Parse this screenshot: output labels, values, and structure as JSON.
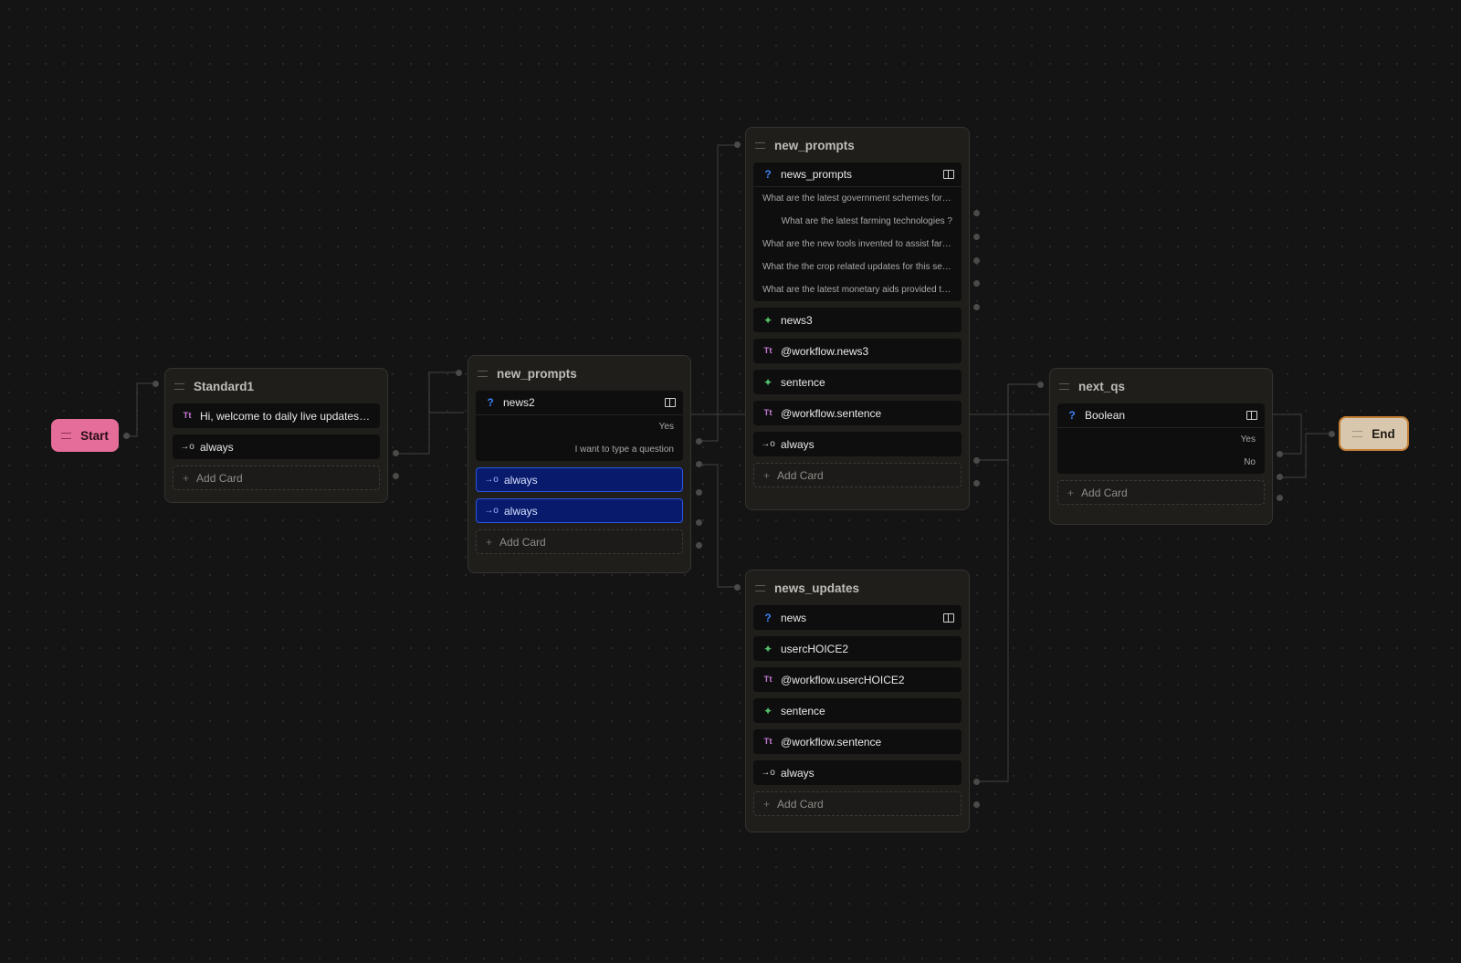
{
  "terminals": {
    "start_label": "Start",
    "end_label": "End"
  },
  "nodes": {
    "standard1": {
      "title": "Standard1",
      "rows": [
        {
          "icon": "text-icon",
          "text": "Hi, welcome to daily live updates by..."
        },
        {
          "icon": "arrow-icon",
          "text": "always"
        }
      ],
      "add_card": "Add Card"
    },
    "new_prompts_a": {
      "title": "new_prompts",
      "question": {
        "icon": "question-icon",
        "label": "news2",
        "options": [
          "Yes",
          "I want to type a question"
        ]
      },
      "rows": [
        {
          "icon": "arrow-icon",
          "text": "always"
        },
        {
          "icon": "arrow-icon",
          "text": "always"
        }
      ],
      "add_card": "Add Card"
    },
    "new_prompts_b": {
      "title": "new_prompts",
      "question": {
        "icon": "question-icon",
        "label": "news_prompts",
        "options": [
          "What are the latest government schemes for f...",
          "What are the latest farming technologies ?",
          "What are the new tools invented to assist farm...",
          "What the the crop related updates for this sea...",
          "What are the latest monetary aids provided to ..."
        ]
      },
      "rows": [
        {
          "icon": "sparkle-icon",
          "text": "news3"
        },
        {
          "icon": "text-icon",
          "text": "@workflow.news3"
        },
        {
          "icon": "sparkle-icon",
          "text": "sentence"
        },
        {
          "icon": "text-icon",
          "text": "@workflow.sentence"
        },
        {
          "icon": "arrow-icon",
          "text": "always"
        }
      ],
      "add_card": "Add Card"
    },
    "news_updates": {
      "title": "news_updates",
      "question": {
        "icon": "question-icon",
        "label": "news"
      },
      "rows": [
        {
          "icon": "sparkle-icon",
          "text": "usercHOICE2"
        },
        {
          "icon": "text-icon",
          "text": "@workflow.usercHOICE2"
        },
        {
          "icon": "sparkle-icon",
          "text": "sentence"
        },
        {
          "icon": "text-icon",
          "text": "@workflow.sentence"
        },
        {
          "icon": "arrow-icon",
          "text": "always"
        }
      ],
      "add_card": "Add Card"
    },
    "next_qs": {
      "title": "next_qs",
      "question": {
        "icon": "question-icon",
        "label": "Boolean",
        "options": [
          "Yes",
          "No"
        ]
      },
      "add_card": "Add Card"
    }
  },
  "colors": {
    "canvas": "#141414",
    "node_bg": "#1f1e1b",
    "selected_row": "#071a6b",
    "start": "#e56d9a",
    "end": "#d8c7ad",
    "end_border": "#c47f36"
  }
}
